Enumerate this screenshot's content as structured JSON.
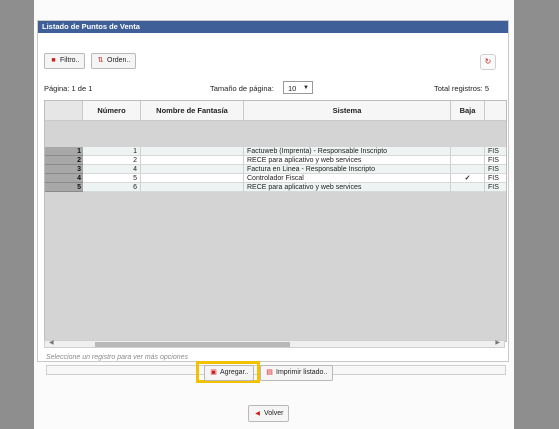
{
  "panel": {
    "title": "Listado de Puntos de Venta"
  },
  "toolbar": {
    "filter_label": "Filtro..",
    "order_label": "Orden.."
  },
  "pager": {
    "page_label": "Página: 1 de 1",
    "page_size_label": "Tamaño de página:",
    "page_size_value": "10",
    "total_label": "Total registros: 5"
  },
  "table": {
    "headers": [
      "Número",
      "Nombre de Fantasía",
      "Sistema",
      "Baja",
      ""
    ],
    "rows": [
      {
        "idx": "1",
        "numero": "1",
        "fantasia": "",
        "sistema": "Factuweb (Imprenta) - Responsable Inscripto",
        "baja": "",
        "extra": "FIS"
      },
      {
        "idx": "2",
        "numero": "2",
        "fantasia": "",
        "sistema": "RECE para aplicativo y web services",
        "baja": "",
        "extra": "FIS"
      },
      {
        "idx": "3",
        "numero": "4",
        "fantasia": "",
        "sistema": "Factura en Linea - Responsable Inscripto",
        "baja": "",
        "extra": "FIS"
      },
      {
        "idx": "4",
        "numero": "5",
        "fantasia": "",
        "sistema": "Controlador Fiscal",
        "baja": "✓",
        "extra": "FIS"
      },
      {
        "idx": "5",
        "numero": "6",
        "fantasia": "",
        "sistema": "RECE para aplicativo y web services",
        "baja": "",
        "extra": "FIS"
      }
    ]
  },
  "hint": "Seleccione un registro para ver más opciones",
  "actions": {
    "add_label": "Agregar..",
    "print_label": "Imprimir listado..",
    "back_label": "Volver"
  },
  "colors": {
    "header": "#3e5f97",
    "highlight": "#f2c200",
    "accent_red": "#d21a1a"
  }
}
